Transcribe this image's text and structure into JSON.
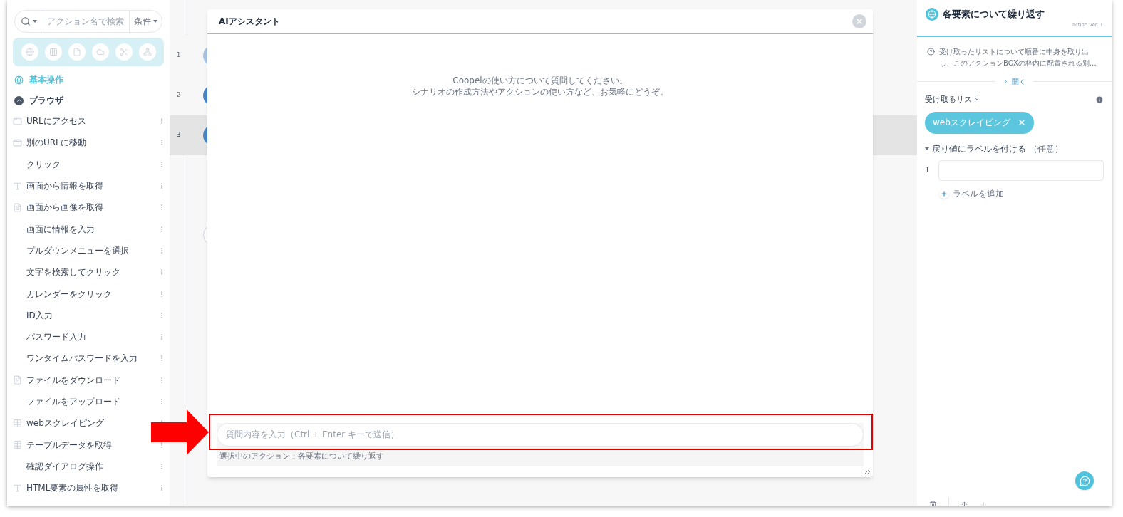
{
  "search": {
    "placeholder": "アクション名で検索",
    "condition_label": "条件"
  },
  "sidebar": {
    "category": {
      "label": "基本操作"
    },
    "group": {
      "label": "ブラウザ",
      "expanded": true
    },
    "items": [
      {
        "label": "URLにアクセス",
        "kind": "window"
      },
      {
        "label": "別のURLに移動",
        "kind": "window"
      },
      {
        "label": "クリック",
        "kind": "none"
      },
      {
        "label": "画面から情報を取得",
        "kind": "text"
      },
      {
        "label": "画面から画像を取得",
        "kind": "file"
      },
      {
        "label": "画面に情報を入力",
        "kind": "none"
      },
      {
        "label": "プルダウンメニューを選択",
        "kind": "none"
      },
      {
        "label": "文字を検索してクリック",
        "kind": "none"
      },
      {
        "label": "カレンダーをクリック",
        "kind": "none"
      },
      {
        "label": "ID入力",
        "kind": "none"
      },
      {
        "label": "パスワード入力",
        "kind": "none"
      },
      {
        "label": "ワンタイムパスワードを入力",
        "kind": "none"
      },
      {
        "label": "ファイルをダウンロード",
        "kind": "file"
      },
      {
        "label": "ファイルをアップロード",
        "kind": "none"
      },
      {
        "label": "webスクレイピング",
        "kind": "table"
      },
      {
        "label": "テーブルデータを取得",
        "kind": "table"
      },
      {
        "label": "確認ダイアログ操作",
        "kind": "none"
      },
      {
        "label": "HTML要素の属性を取得",
        "kind": "text"
      }
    ]
  },
  "canvas": {
    "rows": [
      {
        "number": "1",
        "selected": false
      },
      {
        "number": "2",
        "selected": false
      },
      {
        "number": "3",
        "selected": true
      }
    ]
  },
  "assistant": {
    "title": "AIアシスタント",
    "intro": [
      "Coopelの使い方について質問してください。",
      "シナリオの作成方法やアクションの使い方など、お気軽にどうぞ。"
    ],
    "input_placeholder": "質問内容を入力（Ctrl + Enter キーで送信）",
    "selected_action": "選択中のアクション：各要素について繰り返す"
  },
  "panel": {
    "title": "各要素について繰り返す",
    "version": "action ver. 1",
    "description": "受け取ったリストについて順番に中身を取り出し、このアクションBOXの枠内に配置される別…",
    "toggle": "開く",
    "list_label": "受け取るリスト",
    "chip": "webスクレイピング",
    "labels": {
      "title": "戻り値にラベルを付ける",
      "note": "（任意）",
      "expanded": true,
      "rows": [
        {
          "number": "1"
        }
      ],
      "add": "ラベルを追加"
    }
  }
}
